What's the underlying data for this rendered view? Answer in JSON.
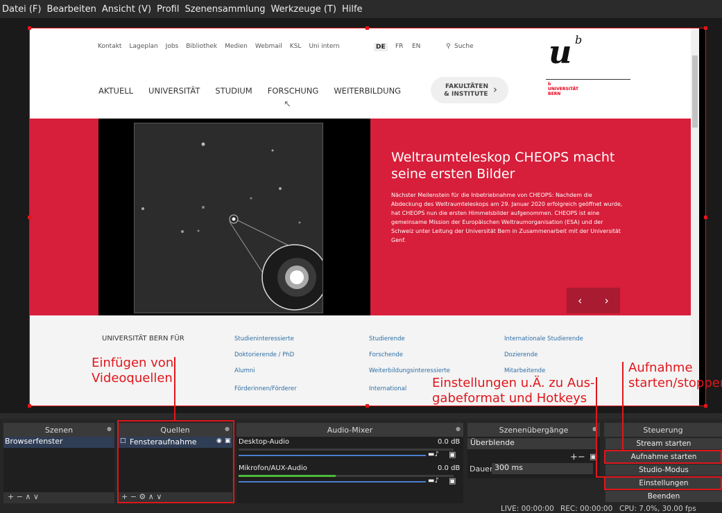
{
  "menu": [
    "Datei (F)",
    "Bearbeiten",
    "Ansicht (V)",
    "Profil",
    "Szenensammlung",
    "Werkzeuge (T)",
    "Hilfe"
  ],
  "website": {
    "toplinks": [
      "Kontakt",
      "Lageplan",
      "Jobs",
      "Bibliothek",
      "Medien",
      "Webmail",
      "KSL",
      "Uni intern"
    ],
    "languages": [
      "DE",
      "FR",
      "EN"
    ],
    "search": "Suche",
    "mainnav": [
      "AKTUELL",
      "UNIVERSITÄT",
      "STUDIUM",
      "FORSCHUNG",
      "WEITERBILDUNG"
    ],
    "faculty_button_line1": "FAKULTÄTEN",
    "faculty_button_line2": "& INSTITUTE",
    "faculty_arrow": "›",
    "logo_u": "u",
    "logo_b": "b",
    "logo_b_small": "b",
    "logo_text_line1": "UNIVERSITÄT",
    "logo_text_line2": "BERN",
    "hero_title": "Weltraumteleskop CHEOPS macht seine ersten Bilder",
    "hero_body": "Nächster Meilenstein für die Inbetriebnahme von CHEOPS: Nachdem die Abdeckung des Weltraumteleskops am 29. Januar 2020 erfolgreich geöffnet wurde, hat CHEOPS nun die ersten Himmelsbilder aufgenommen. CHEOPS ist eine gemeinsame Mission der Europäischen Weltraumorganisation (ESA) und der Schweiz unter Leitung der Universität Bern in Zusammenarbeit mit der Universität Genf.",
    "hero_prev": "‹",
    "hero_next": "›",
    "uni_for": "UNIVERSITÄT BERN FÜR",
    "audience_col1": [
      "Studieninteressierte",
      "Doktorierende / PhD",
      "Alumni",
      "Förderinnen/Förderer"
    ],
    "audience_col2": [
      "Studierende",
      "Forschende",
      "Weiterbildungsinteressierte",
      "International"
    ],
    "audience_col3": [
      "Internationale Studierende",
      "Dozierende",
      "Mitarbeitende"
    ]
  },
  "annotations": {
    "sources_line1": "Einfügen von",
    "sources_line2": "Videoquellen",
    "settings_line1": "Einstellungen u.Ä. zu Aus-",
    "settings_line2": "gabeformat und Hotkeys",
    "record_line1": "Aufnahme",
    "record_line2": "starten/stoppen"
  },
  "docks": {
    "scenes": {
      "title": "Szenen",
      "items": [
        "Browserfenster"
      ],
      "controls": "+ −  ∧ ∨"
    },
    "sources": {
      "title": "Quellen",
      "items": [
        "Fensteraufnahme"
      ],
      "controls": "+ − ⚙  ∧ ∨"
    },
    "mixer": {
      "title": "Audio-Mixer",
      "channels": [
        {
          "name": "Desktop-Audio",
          "level": "0.0 dB",
          "fill": 0.0
        },
        {
          "name": "Mikrofon/AUX-Audio",
          "level": "0.0 dB",
          "fill": 0.45
        }
      ]
    },
    "transitions": {
      "title": "Szenenübergänge",
      "selected": "Überblende",
      "duration_label": "Dauer",
      "duration": "300 ms",
      "controls": "+−"
    },
    "controls": {
      "title": "Steuerung",
      "buttons": [
        "Stream starten",
        "Aufnahme starten",
        "Studio-Modus",
        "Einstellungen",
        "Beenden"
      ]
    }
  },
  "status": {
    "live": "LIVE: 00:00:00",
    "rec": "REC: 00:00:00",
    "cpu": "CPU: 7.0%, 30.00 fps"
  },
  "colors": {
    "annotation": "#e0161b",
    "hero": "#d71e3a",
    "link": "#2d6ea5"
  }
}
